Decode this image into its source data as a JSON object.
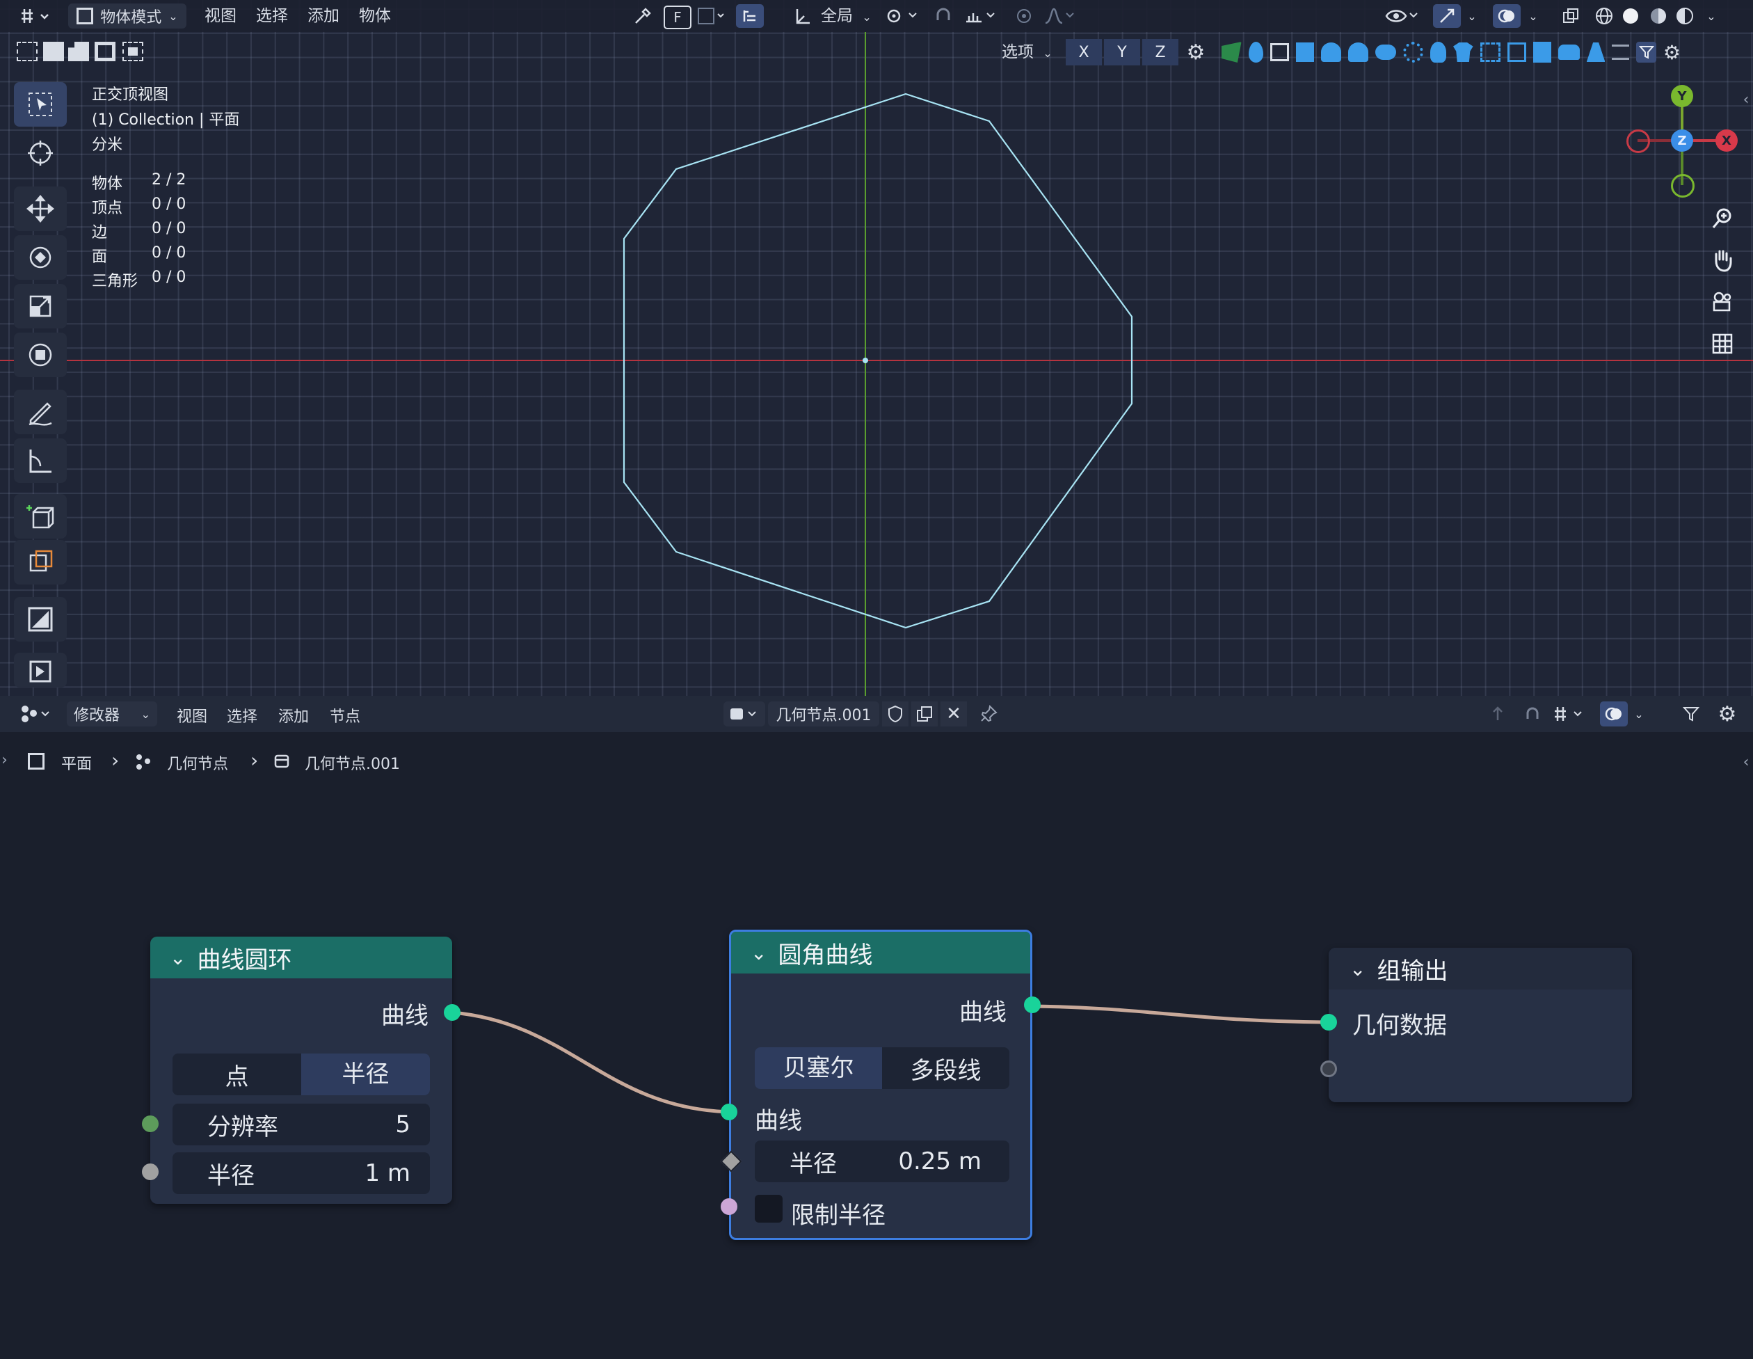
{
  "viewport": {
    "header": {
      "mode": "物体模式",
      "menus": [
        "视图",
        "选择",
        "添加",
        "物体"
      ],
      "transform_orientation": "全局",
      "options": "选项",
      "axes": [
        "X",
        "Y",
        "Z"
      ]
    },
    "overlay": {
      "view_name": "正交顶视图",
      "collection": "(1) Collection | 平面",
      "unit": "分米",
      "stats": [
        {
          "label": "物体",
          "value": "2 / 2"
        },
        {
          "label": "顶点",
          "value": "0 / 0"
        },
        {
          "label": "边",
          "value": "0 / 0"
        },
        {
          "label": "面",
          "value": "0 / 0"
        },
        {
          "label": "三角形",
          "value": "0 / 0"
        }
      ]
    },
    "gizmo": {
      "y": "Y",
      "z": "Z",
      "x": "X"
    },
    "colors": {
      "grid": "#2d3447",
      "x_axis": "#b5333f",
      "y_axis": "#5a9e2f",
      "curve": "#a8e4f4"
    }
  },
  "node_editor": {
    "header": {
      "editor": "修改器",
      "menus": [
        "视图",
        "选择",
        "添加",
        "节点"
      ],
      "node_group": "几何节点.001"
    },
    "breadcrumb": [
      "平面",
      "几何节点",
      "几何节点.001"
    ],
    "nodes": {
      "curve_circle": {
        "title": "曲线圆环",
        "output": "曲线",
        "mode_left": "点",
        "mode_right": "半径",
        "resolution_label": "分辨率",
        "resolution_value": "5",
        "radius_label": "半径",
        "radius_value": "1 m"
      },
      "fillet_curve": {
        "title": "圆角曲线",
        "output": "曲线",
        "mode_left": "贝塞尔",
        "mode_right": "多段线",
        "input_curve": "曲线",
        "radius_label": "半径",
        "radius_value": "0.25 m",
        "limit_label": "限制半径"
      },
      "group_output": {
        "title": "组输出",
        "input": "几何数据"
      }
    },
    "colors": {
      "node_header": "#1b6e66",
      "socket_geometry": "#19d39a",
      "socket_int": "#5d9c5b",
      "socket_float": "#a1a1a1",
      "socket_bool": "#cca6d6",
      "link": "#c8a99a"
    }
  }
}
